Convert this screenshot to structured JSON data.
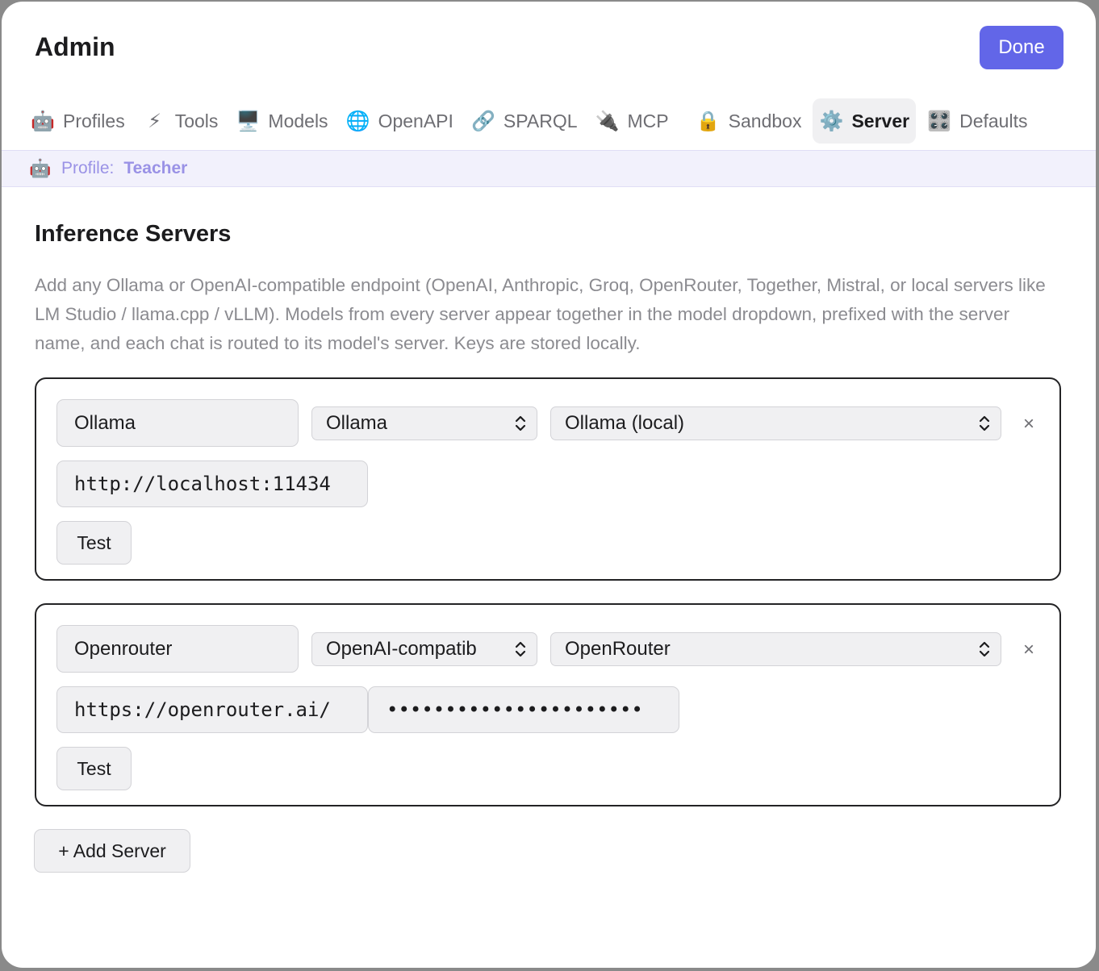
{
  "header": {
    "title": "Admin",
    "done_label": "Done"
  },
  "tabs": [
    {
      "icon": "🤖",
      "icon_name": "robot-icon",
      "label": "Profiles"
    },
    {
      "icon": "⚡",
      "icon_name": "lightning-icon",
      "label": "Tools"
    },
    {
      "icon": "🖥️",
      "icon_name": "monitor-icon",
      "label": "Models"
    },
    {
      "icon": "🌐",
      "icon_name": "globe-icon",
      "label": "OpenAPI"
    },
    {
      "icon": "🔗",
      "icon_name": "link-icon",
      "label": "SPARQL"
    },
    {
      "icon": "🔌",
      "icon_name": "plug-icon",
      "label": "MCP"
    },
    {
      "icon": "🔒",
      "icon_name": "lock-icon",
      "label": "Sandbox"
    },
    {
      "icon": "⚙️",
      "icon_name": "gear-icon",
      "label": "Server",
      "active": true
    },
    {
      "icon": "🎛️",
      "icon_name": "control-knobs-icon",
      "label": "Defaults"
    }
  ],
  "profile": {
    "icon": "🤖",
    "label": "Profile:",
    "name": "Teacher"
  },
  "section": {
    "title": "Inference Servers",
    "description": "Add any Ollama or OpenAI-compatible endpoint (OpenAI, Anthropic, Groq, OpenRouter, Together, Mistral, or local servers like LM Studio / llama.cpp / vLLM). Models from every server appear together in the model dropdown, prefixed with the server name, and each chat is routed to its model's server. Keys are stored locally."
  },
  "servers": [
    {
      "name": "Ollama",
      "type": "Ollama",
      "preset": "Ollama (local)",
      "url": "http://localhost:11434",
      "test_label": "Test",
      "remove_label": "×"
    },
    {
      "name": "Openrouter",
      "type": "OpenAI-compatib",
      "preset": "OpenRouter",
      "url": "https://openrouter.ai/",
      "api_key_masked": "••••••••••••••••••••••",
      "test_label": "Test",
      "remove_label": "×"
    }
  ],
  "add_server_label": "+ Add Server",
  "colors": {
    "accent": "#6266e8",
    "profile_text": "#9a92e6",
    "profile_bg": "#f2f1fc"
  }
}
